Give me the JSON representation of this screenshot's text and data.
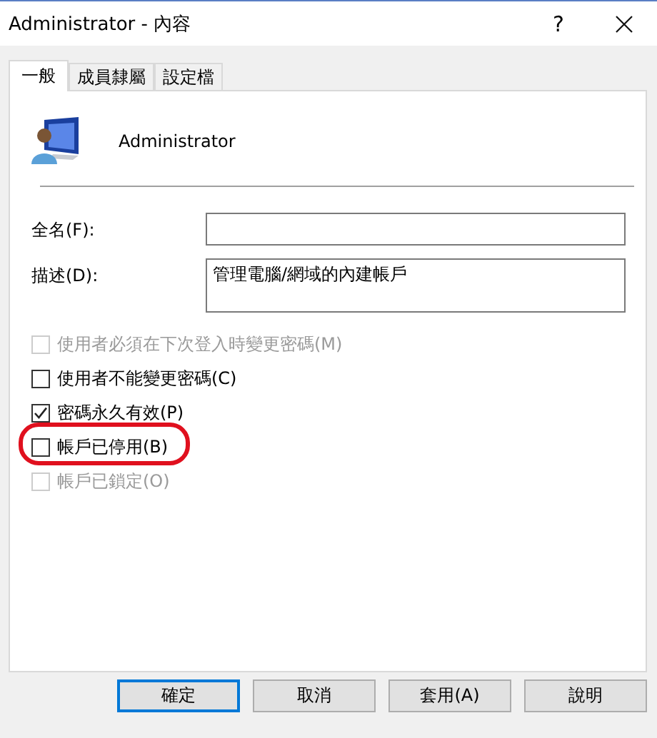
{
  "window": {
    "title": "Administrator - 內容"
  },
  "title_buttons": [
    {
      "kind": "help",
      "label": "?"
    },
    {
      "kind": "close"
    }
  ],
  "tabs": [
    {
      "label": "一般",
      "selected": true
    },
    {
      "label": "成員隸屬",
      "selected": false
    },
    {
      "label": "設定檔",
      "selected": false
    }
  ],
  "account": {
    "name": "Administrator"
  },
  "fields": [
    {
      "label": "全名(F):",
      "kind": "line"
    },
    {
      "label": "描述(D):",
      "kind": "area",
      "value": "管理電腦/網域的內建帳戶"
    }
  ],
  "options": [
    {
      "label": "使用者必須在下次登入時變更密碼(M)",
      "checked": false,
      "disabled": true,
      "highlighted": false
    },
    {
      "label": "使用者不能變更密碼(C)",
      "checked": false,
      "disabled": false,
      "highlighted": false
    },
    {
      "label": "密碼永久有效(P)",
      "checked": true,
      "disabled": false,
      "highlighted": false
    },
    {
      "label": "帳戶已停用(B)",
      "checked": false,
      "disabled": false,
      "highlighted": true
    },
    {
      "label": "帳戶已鎖定(O)",
      "checked": false,
      "disabled": true,
      "highlighted": false
    }
  ],
  "buttons": [
    {
      "label": "確定",
      "default": true
    },
    {
      "label": "取消",
      "default": false
    },
    {
      "label": "套用(A)",
      "default": false
    },
    {
      "label": "說明",
      "default": false
    }
  ]
}
